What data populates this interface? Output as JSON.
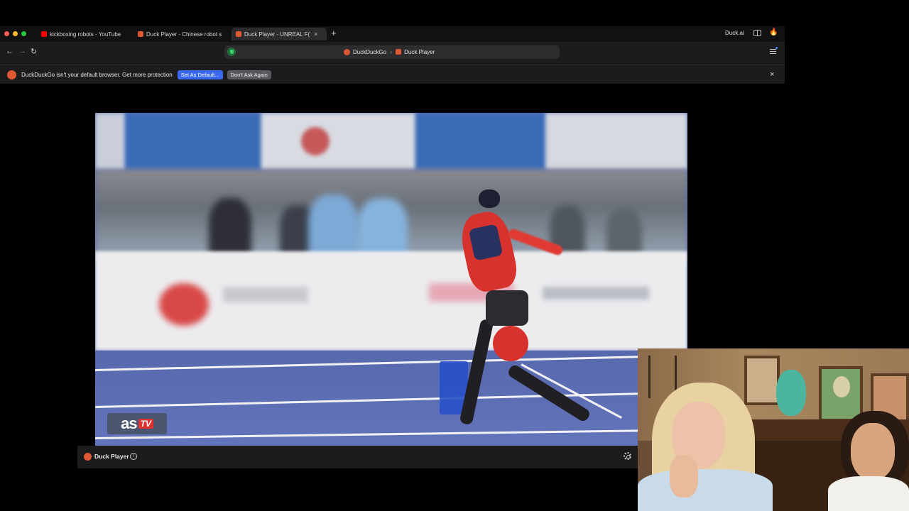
{
  "browser": {
    "tabs": [
      {
        "title": "kickboxing robots - YouTube",
        "favicon": "youtube-icon",
        "active": false
      },
      {
        "title": "Duck Player - Chinese robot sm",
        "favicon": "duck-player-icon",
        "active": false
      },
      {
        "title": "Duck Player - UNREAL F(",
        "favicon": "duck-player-icon",
        "active": true
      }
    ],
    "new_tab_label": "+",
    "tab_close_glyph": "×",
    "duck_ai_label": "Duck.ai",
    "address": {
      "crumbs": [
        "DuckDuckGo",
        "Duck Player"
      ],
      "separator": "›"
    },
    "nav": {
      "back": "←",
      "forward": "→",
      "reload": "↻"
    },
    "colors": {
      "accent": "#3969ef",
      "brand": "#de5833",
      "shield": "#3ecf6a"
    }
  },
  "notice": {
    "message": "DuckDuckGo isn't your default browser. Get more protection",
    "primary_button": "Set As Default...",
    "secondary_button": "Don't Ask Again",
    "close_glyph": "×"
  },
  "video": {
    "watermark_as": "as",
    "watermark_tv": "TV"
  },
  "player_bar": {
    "label": "Duck Player",
    "info_glyph": "i"
  }
}
